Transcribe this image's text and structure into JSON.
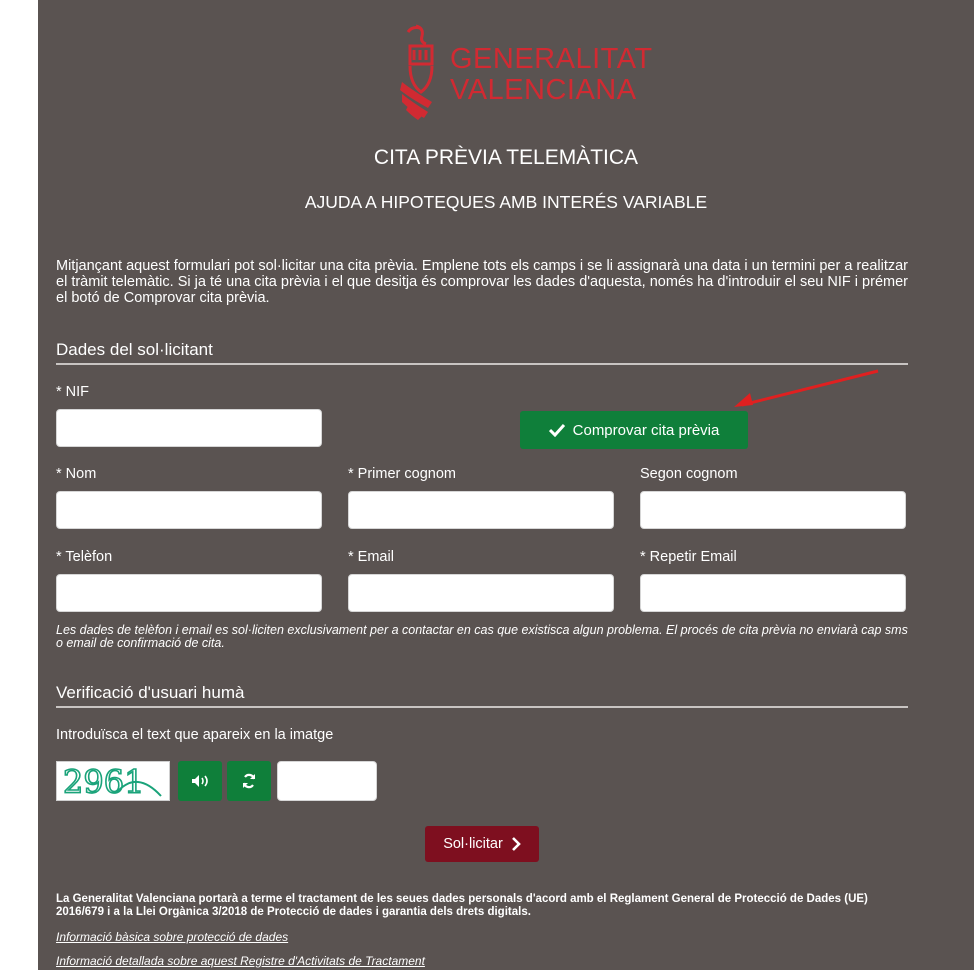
{
  "branding": {
    "logo_line1": "GENERALITAT",
    "logo_line2": "VALENCIANA",
    "brand_red": "#d12a32"
  },
  "page": {
    "title": "CITA PRÈVIA TELEMÀTICA",
    "subtitle": "AJUDA A HIPOTEQUES AMB INTERÉS VARIABLE",
    "intro": "Mitjançant aquest formulari pot sol·licitar una cita prèvia. Emplene tots els camps i se li assignarà una data i un termini per a realitzar el tràmit telemàtic. Si ja té una cita prèvia i el que desitja és comprovar les dades d'aquesta, només ha d'introduir el seu NIF i prémer el botó de Comprovar cita prèvia."
  },
  "applicant": {
    "heading": "Dades del sol·licitant",
    "nif_label": "* NIF",
    "nif_value": "",
    "check_button": "Comprovar cita prèvia",
    "name_label": "* Nom",
    "surname1_label": "* Primer cognom",
    "surname2_label": "Segon cognom",
    "phone_label": "* Telèfon",
    "email_label": "* Email",
    "email_repeat_label": "* Repetir Email",
    "note": "Les dades de telèfon i email es sol·liciten exclusivament per a contactar en cas que existisca algun problema. El procés de cita prèvia no enviarà cap sms o email de confirmació de cita."
  },
  "verification": {
    "heading": "Verificació d'usuari humà",
    "instruction": "Introduïsca el text que apareix en la imatge",
    "captcha_text": "2961",
    "audio_icon": "volume-icon",
    "refresh_icon": "refresh-icon",
    "captcha_input": ""
  },
  "submit": {
    "label": "Sol·licitar"
  },
  "legal": {
    "text": "La Generalitat Valenciana portarà a terme el tractament de les seues dades personals d'acord amb el Reglament General de Protecció de Dades (UE) 2016/679 i a la Llei Orgànica 3/2018 de Protecció de dades i garantia dels drets digitals.",
    "link1": "Informació bàsica sobre protecció de dades",
    "link2": "Informació detallada sobre aquest Registre d'Activitats de Tractament"
  },
  "colors": {
    "panel_bg": "#5a5351",
    "green": "#0f7f3a",
    "dark_red": "#7e0f1f",
    "arrow": "#e02020"
  }
}
